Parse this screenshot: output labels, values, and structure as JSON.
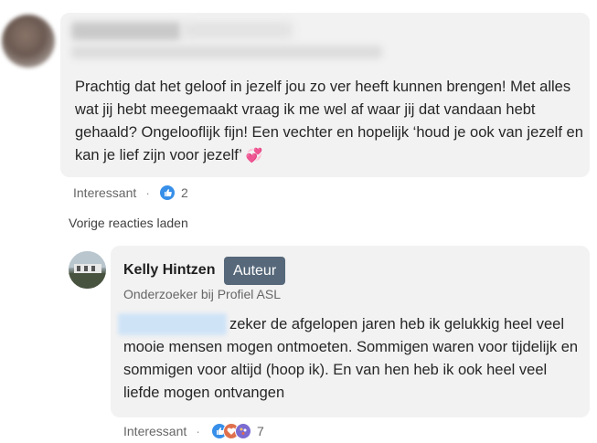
{
  "first_comment": {
    "text": "Prachtig dat het geloof in jezelf jou zo ver heeft kunnen brengen! Met alles wat jij hebt meegemaakt vraag ik me wel af waar jij dat vandaan hebt gehaald? Ongelooflijk fijn! Een vechter en hopelijk ‘houd je ook van jezelf en kan je lief zijn voor jezelf’",
    "emoji": "💞",
    "reaction_label": "Interessant",
    "reaction_count": "2"
  },
  "load_more": "Vorige reacties laden",
  "reply": {
    "author": "Kelly Hintzen",
    "badge": "Auteur",
    "headline": "Onderzoeker bij Profiel ASL",
    "text": "zeker de afgelopen jaren heb ik gelukkig heel veel mooie mensen mogen ontmoeten. Sommigen waren voor tijdelijk en sommigen voor altijd (hoop ik). En van hen heb ik ook heel veel liefde mogen ontvangen",
    "reaction_label": "Interessant",
    "reaction_count": "7"
  },
  "icons": [
    "like-icon",
    "celebrate-icon",
    "love-icon",
    "insightful-icon"
  ],
  "colors": {
    "like": "#378fe9",
    "badge": "#56687a",
    "bubble": "#f2f2f2"
  }
}
